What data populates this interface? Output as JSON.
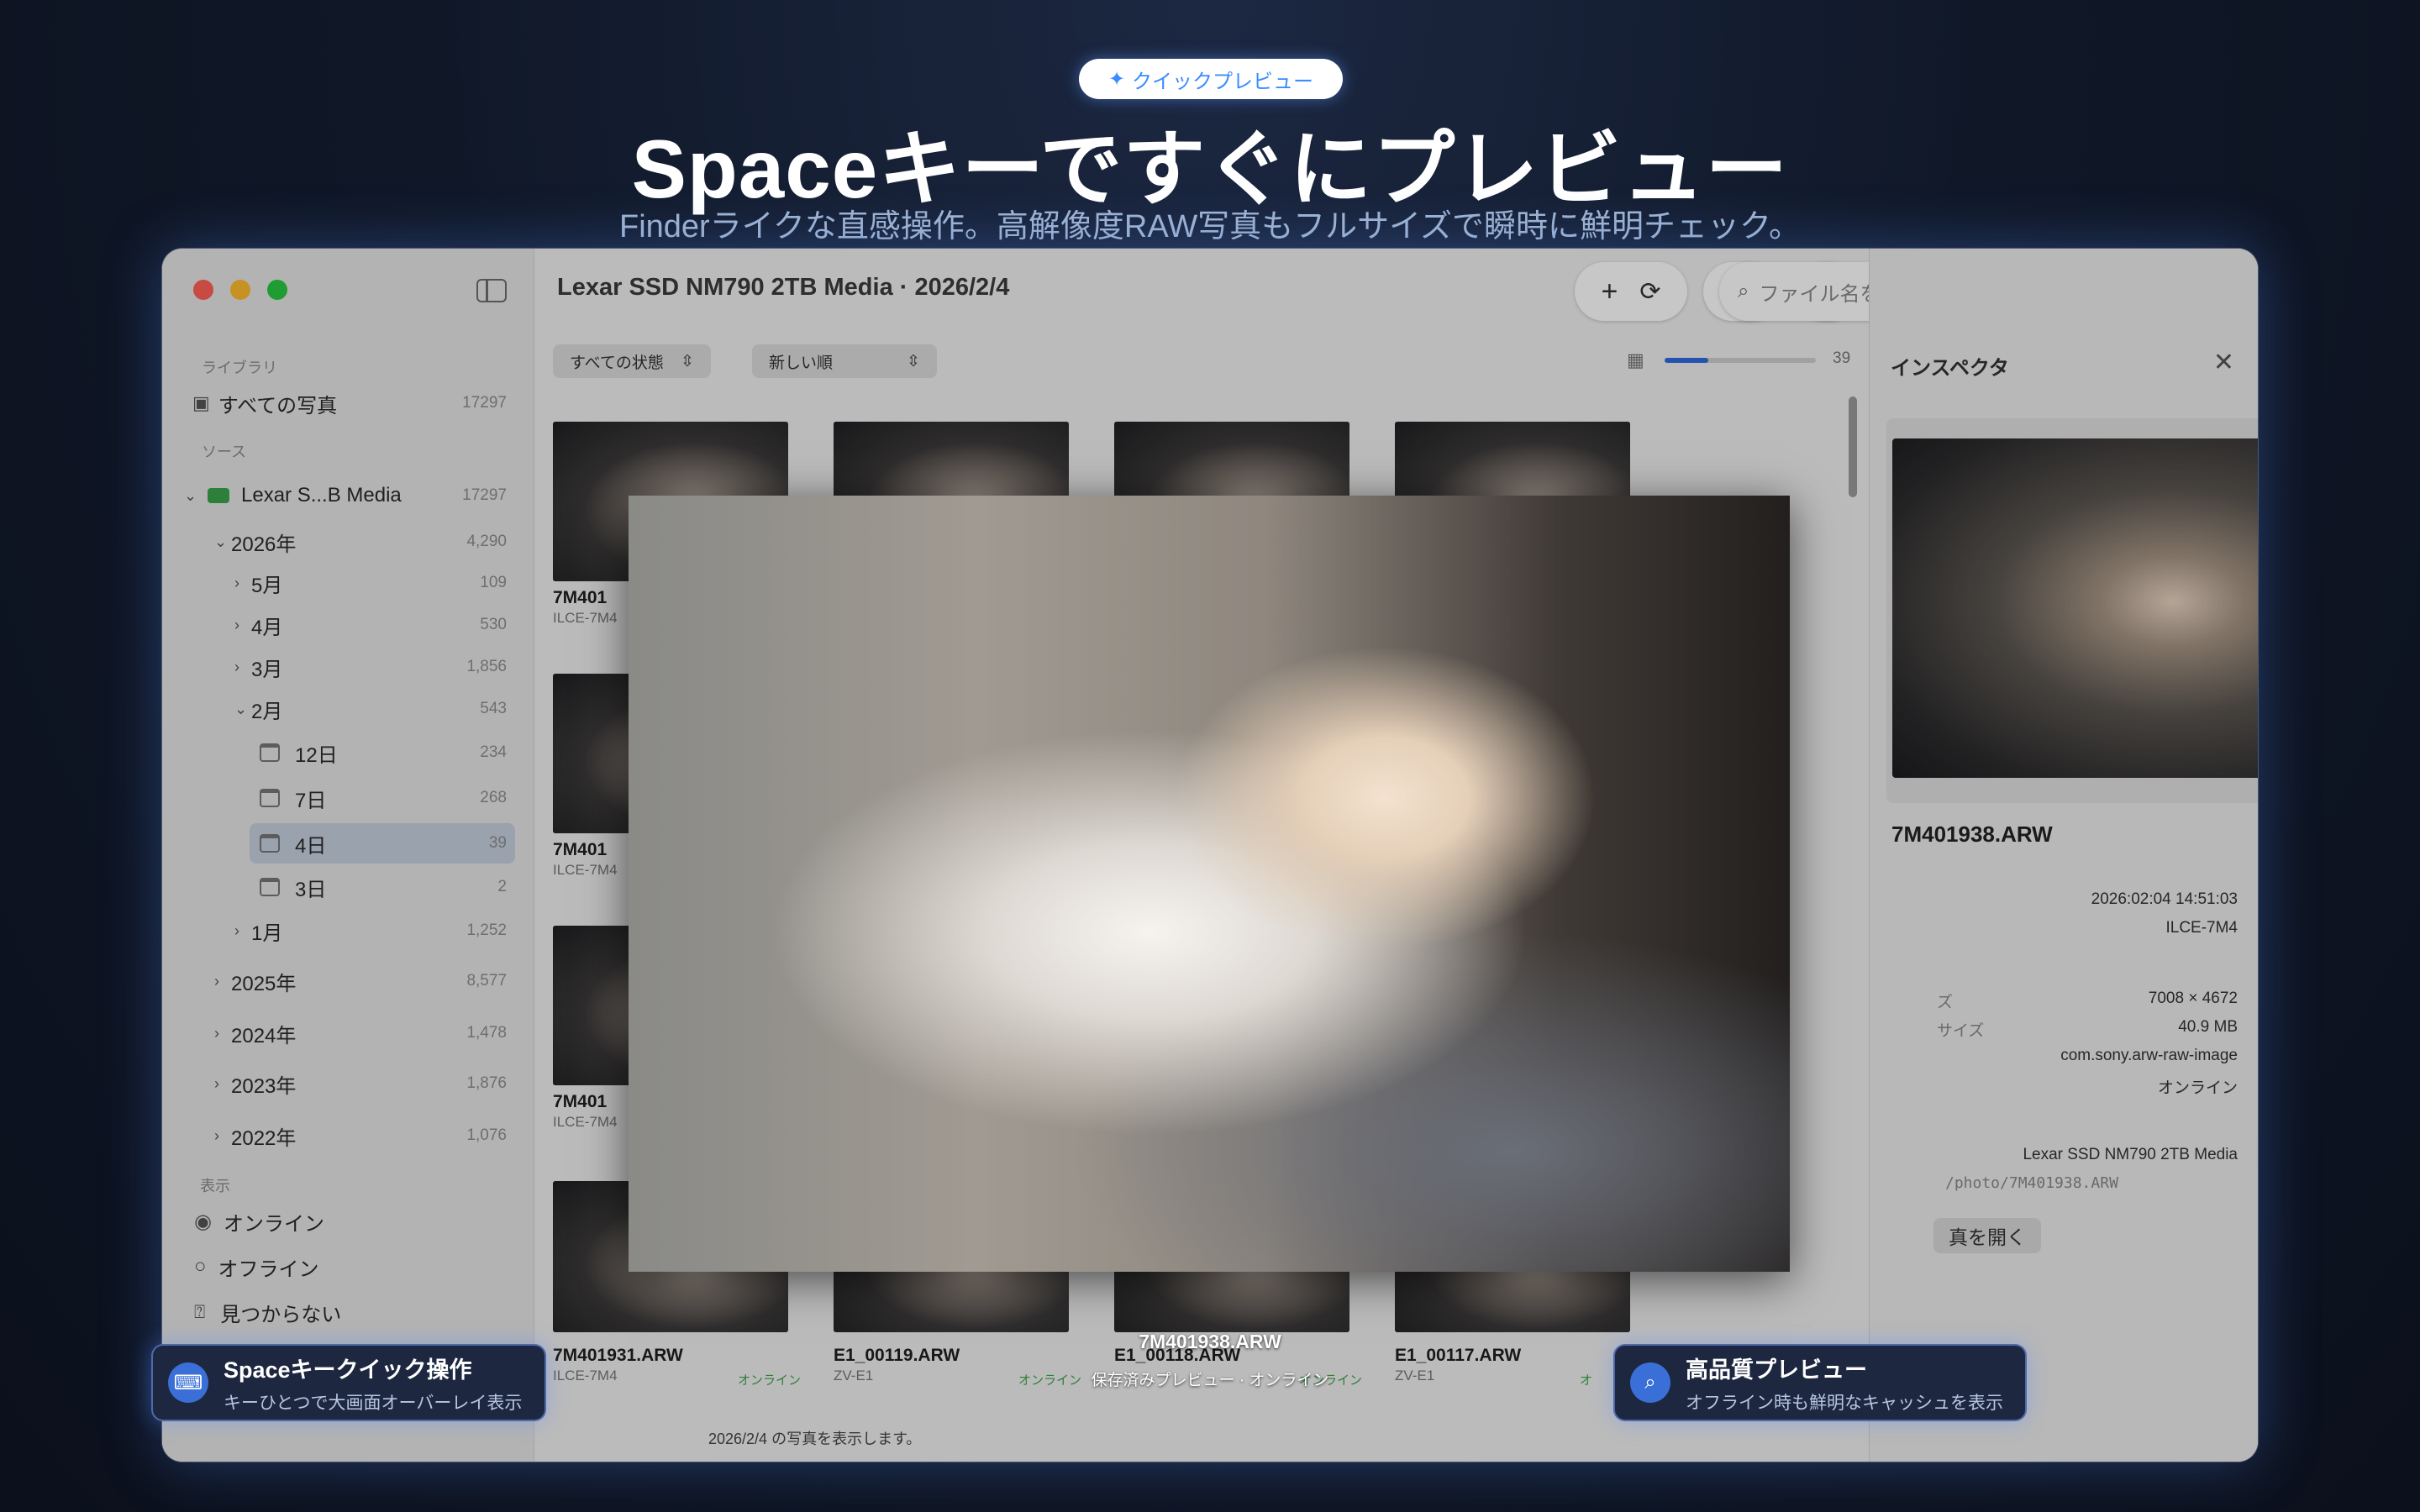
{
  "hero": {
    "badge": "クイックプレビュー",
    "badge_icon": "sparkle-icon",
    "title": "Spaceキーですぐにプレビュー",
    "subtitle": "Finderライクな直感操作。高解像度RAW写真もフルサイズで瞬時に鮮明チェック。"
  },
  "window": {
    "title": "Lexar SSD NM790 2TB Media · 2026/2/4",
    "search_placeholder": "ファイル名を検索"
  },
  "sidebar": {
    "library_label": "ライブラリ",
    "all_photos": {
      "label": "すべての写真",
      "count": "17297"
    },
    "sources_label": "ソース",
    "source": {
      "label": "Lexar S...B Media",
      "count": "17297"
    },
    "tree": [
      {
        "label": "2026年",
        "count": "4,290"
      },
      {
        "label": "5月",
        "count": "109"
      },
      {
        "label": "4月",
        "count": "530"
      },
      {
        "label": "3月",
        "count": "1,856"
      },
      {
        "label": "2月",
        "count": "543"
      },
      {
        "label": "12日",
        "count": "234"
      },
      {
        "label": "7日",
        "count": "268"
      },
      {
        "label": "4日",
        "count": "39"
      },
      {
        "label": "3日",
        "count": "2"
      },
      {
        "label": "1月",
        "count": "1,252"
      },
      {
        "label": "2025年",
        "count": "8,577"
      },
      {
        "label": "2024年",
        "count": "1,478"
      },
      {
        "label": "2023年",
        "count": "1,876"
      },
      {
        "label": "2022年",
        "count": "1,076"
      }
    ],
    "display_label": "表示",
    "filters": [
      {
        "label": "オンライン"
      },
      {
        "label": "オフライン"
      },
      {
        "label": "見つからない"
      }
    ]
  },
  "toolbar": {
    "filter_state": "すべての状態",
    "sort": "新しい順",
    "thumb_count": "39"
  },
  "grid": {
    "cells": [
      {
        "name": "7M401",
        "cam": "ILCE-7M4"
      },
      {
        "name": "7M401",
        "cam": "ILCE-7M4"
      },
      {
        "name": "7M401",
        "cam": "ILCE-7M4"
      }
    ],
    "bottom": [
      {
        "name": "7M401931.ARW",
        "cam": "ILCE-7M4",
        "status": "オンライン"
      },
      {
        "name": "E1_00119.ARW",
        "cam": "ZV-E1",
        "status": "オンライン"
      },
      {
        "name": "E1_00118.ARW",
        "cam": "",
        "status": "オンライン"
      },
      {
        "name": "E1_00117.ARW",
        "cam": "ZV-E1",
        "status": "オ"
      }
    ]
  },
  "status_bar": "2026/2/4 の写真を表示します。",
  "inspector": {
    "title": "インスペクタ",
    "filename": "7M401938.ARW",
    "date": "2026:02:04 14:51:03",
    "camera": "ILCE-7M4",
    "size_label": "ズ",
    "dimensions": "7008 × 4672",
    "filesize_label": "サイズ",
    "filesize": "40.9 MB",
    "uti": "com.sony.arw-raw-image",
    "state": "オンライン",
    "volume": "Lexar SSD NM790 2TB Media",
    "path": "/photo/7M401938.ARW",
    "open_btn": "真を開く"
  },
  "overlay": {
    "filename": "7M401938.ARW",
    "subtitle": "保存済みプレビュー · オンライン"
  },
  "callouts": {
    "left": {
      "title": "Spaceキークイック操作",
      "desc": "キーひとつで大画面オーバーレイ表示",
      "icon": "keyboard-icon"
    },
    "right": {
      "title": "高品質プレビュー",
      "desc": "オフライン時も鮮明なキャッシュを表示",
      "icon": "magnifier-icon"
    }
  }
}
